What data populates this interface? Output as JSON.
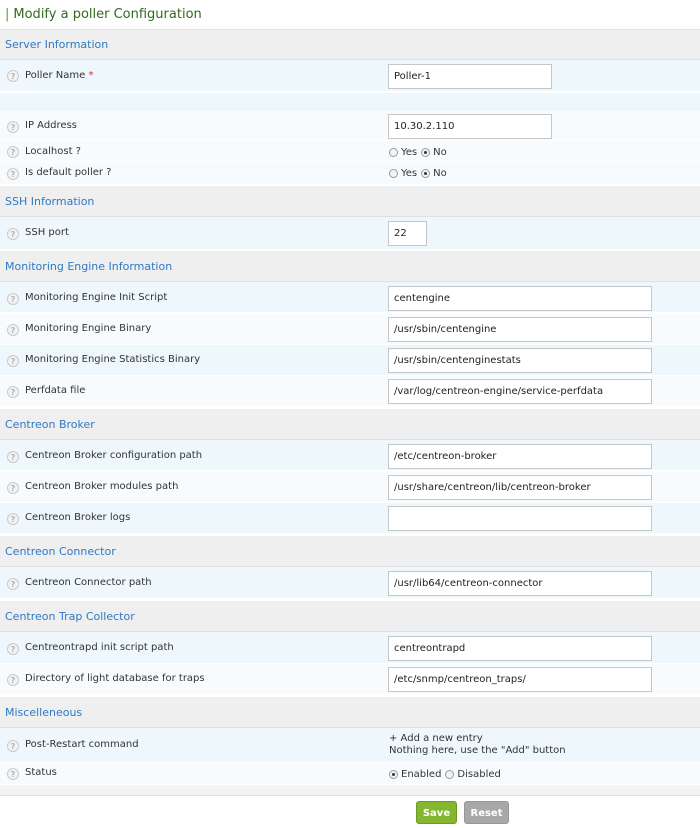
{
  "page": {
    "title": "Modify a poller Configuration",
    "title_bar": "|"
  },
  "help_glyph": "?",
  "sections": {
    "server": "Server Information",
    "ssh": "SSH Information",
    "engine": "Monitoring Engine Information",
    "broker": "Centreon Broker",
    "connector": "Centreon Connector",
    "trap": "Centreon Trap Collector",
    "misc": "Miscelleneous"
  },
  "fields": {
    "poller_name": {
      "label": "Poller Name",
      "required_mark": "*",
      "value": "Poller-1"
    },
    "ip_address": {
      "label": "IP Address",
      "value": "10.30.2.110"
    },
    "localhost": {
      "label": "Localhost ?",
      "yes": "Yes",
      "no": "No",
      "selected": "No"
    },
    "default_poller": {
      "label": "Is default poller ?",
      "yes": "Yes",
      "no": "No",
      "selected": "No"
    },
    "ssh_port": {
      "label": "SSH port",
      "value": "22"
    },
    "engine_init": {
      "label": "Monitoring Engine Init Script",
      "value": "centengine"
    },
    "engine_binary": {
      "label": "Monitoring Engine Binary",
      "value": "/usr/sbin/centengine"
    },
    "engine_stats": {
      "label": "Monitoring Engine Statistics Binary",
      "value": "/usr/sbin/centenginestats"
    },
    "perfdata": {
      "label": "Perfdata file",
      "value": "/var/log/centreon-engine/service-perfdata"
    },
    "broker_config": {
      "label": "Centreon Broker configuration path",
      "value": "/etc/centreon-broker"
    },
    "broker_modules": {
      "label": "Centreon Broker modules path",
      "value": "/usr/share/centreon/lib/centreon-broker"
    },
    "broker_logs": {
      "label": "Centreon Broker logs",
      "value": ""
    },
    "connector_path": {
      "label": "Centreon Connector path",
      "value": "/usr/lib64/centreon-connector"
    },
    "trapd_init": {
      "label": "Centreontrapd init script path",
      "value": "centreontrapd"
    },
    "trap_db_dir": {
      "label": "Directory of light database for traps",
      "value": "/etc/snmp/centreon_traps/"
    },
    "post_restart": {
      "label": "Post-Restart command",
      "add_link": "+ Add a new entry",
      "empty_text": "Nothing here, use the \"Add\" button"
    },
    "status": {
      "label": "Status",
      "enabled": "Enabled",
      "disabled": "Disabled",
      "selected": "Enabled"
    }
  },
  "buttons": {
    "save": "Save",
    "reset": "Reset"
  },
  "colors": {
    "section_title": "#2d79c7",
    "save": "#84b630",
    "reset": "#a8a8a8",
    "required": "#d9231d"
  }
}
